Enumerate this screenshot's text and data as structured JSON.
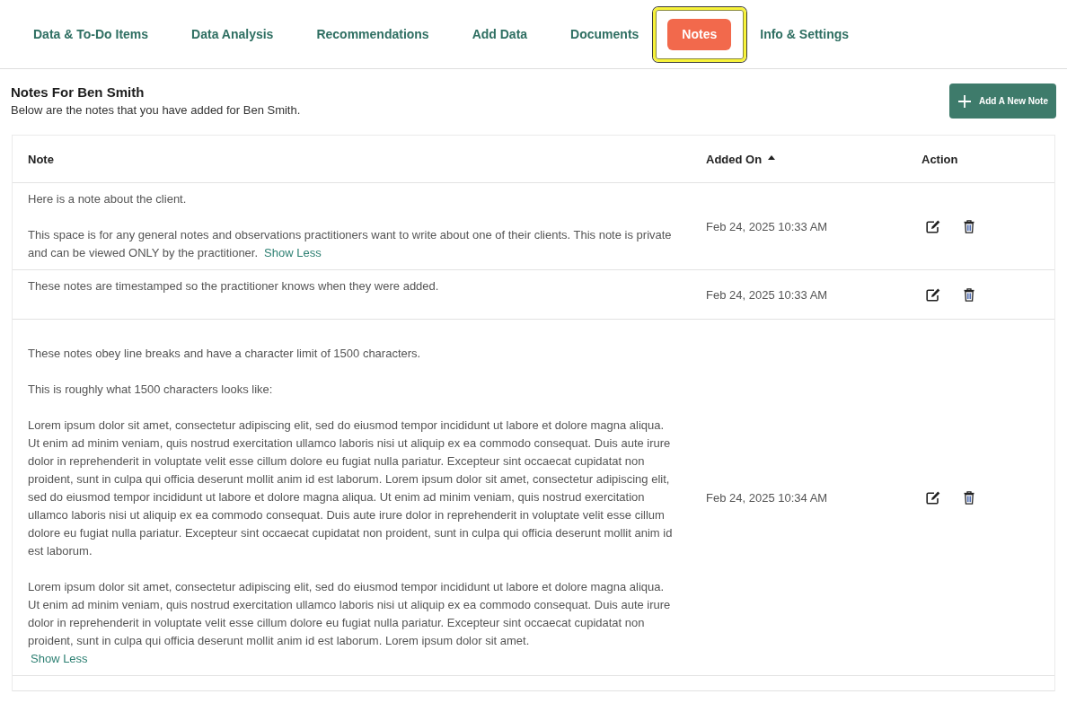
{
  "tabs": [
    {
      "label": "Data & To-Do Items",
      "selected": false,
      "highlighted": false
    },
    {
      "label": "Data Analysis",
      "selected": false,
      "highlighted": false
    },
    {
      "label": "Recommendations",
      "selected": false,
      "highlighted": false
    },
    {
      "label": "Add Data",
      "selected": false,
      "highlighted": false
    },
    {
      "label": "Documents",
      "selected": false,
      "highlighted": false
    },
    {
      "label": "Notes",
      "selected": true,
      "highlighted": true
    },
    {
      "label": "Info & Settings",
      "selected": false,
      "highlighted": false
    }
  ],
  "header": {
    "title": "Notes For Ben Smith",
    "subtitle": "Below are the notes that you have added for Ben Smith.",
    "add_button": "Add A New Note"
  },
  "table": {
    "columns": [
      {
        "label": "Note",
        "sorted": false
      },
      {
        "label": "Added On",
        "sorted": true
      },
      {
        "label": "Action",
        "sorted": false
      }
    ],
    "rows": [
      {
        "leading_blank_line": false,
        "paragraphs": [
          "Here is a note about the client.",
          "This space is for any general notes and observations practitioners want to write about one of their clients.  This note is private and can be viewed ONLY by the practitioner."
        ],
        "toggle": {
          "label": "Show Less",
          "on_own_line": false
        },
        "added_on": "Feb 24, 2025 10:33 AM"
      },
      {
        "leading_blank_line": false,
        "paragraphs": [
          "These notes are timestamped so the practitioner knows when they were added."
        ],
        "added_on": "Feb 24, 2025 10:33 AM"
      },
      {
        "leading_blank_line": true,
        "paragraphs": [
          "These notes obey line breaks and have a character limit of 1500 characters.",
          "This is roughly what 1500 characters looks like:",
          "Lorem ipsum dolor sit amet, consectetur adipiscing elit, sed do eiusmod tempor incididunt ut labore et dolore magna aliqua. Ut enim ad minim veniam, quis nostrud exercitation ullamco laboris nisi ut aliquip ex ea commodo consequat. Duis aute irure dolor in reprehenderit in voluptate velit esse cillum dolore eu fugiat nulla pariatur. Excepteur sint occaecat cupidatat non proident, sunt in culpa qui officia deserunt mollit anim id est laborum. Lorem ipsum dolor sit amet, consectetur adipiscing elit, sed do eiusmod tempor incididunt ut labore et dolore magna aliqua. Ut enim ad minim veniam, quis nostrud exercitation ullamco laboris nisi ut aliquip ex ea commodo consequat. Duis aute irure dolor in reprehenderit in voluptate velit esse cillum dolore eu fugiat nulla pariatur. Excepteur sint occaecat cupidatat non proident, sunt in culpa qui officia deserunt mollit anim id est laborum.",
          "Lorem ipsum dolor sit amet, consectetur adipiscing elit, sed do eiusmod tempor incididunt ut labore et dolore magna aliqua. Ut enim ad minim veniam, quis nostrud exercitation ullamco laboris nisi ut aliquip ex ea commodo consequat. Duis aute irure dolor in reprehenderit in voluptate velit esse cillum dolore eu fugiat nulla pariatur. Excepteur sint occaecat cupidatat non proident, sunt in culpa qui officia deserunt mollit anim id est laborum. Lorem ipsum dolor sit amet."
        ],
        "toggle": {
          "label": "Show Less",
          "on_own_line": true
        },
        "added_on": "Feb 24, 2025 10:34 AM"
      }
    ]
  }
}
